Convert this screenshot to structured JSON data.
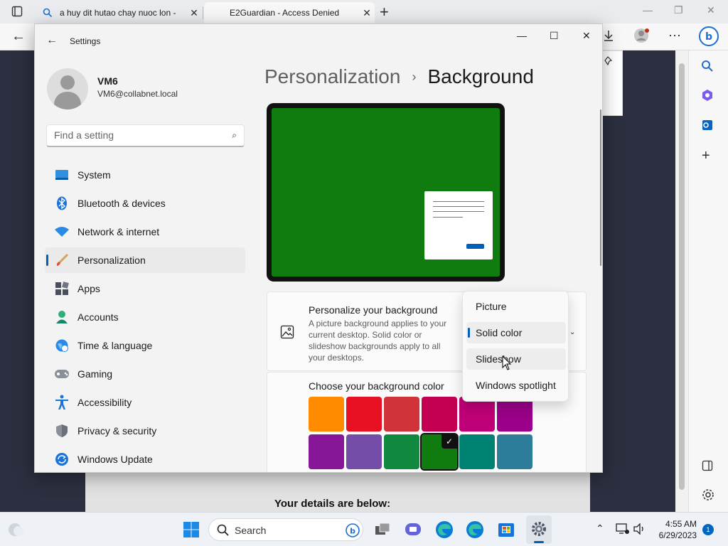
{
  "browser": {
    "tabs": [
      {
        "title": "a huy dit hutao chay nuoc lon -  "
      },
      {
        "title": "E2Guardian - Access Denied"
      }
    ],
    "new_tab_symbol": "+",
    "page_details_text": "Your details are below:"
  },
  "settings": {
    "window_title": "Settings",
    "user": {
      "name": "VM6",
      "email": "VM6@collabnet.local"
    },
    "search_placeholder": "Find a setting",
    "nav": [
      {
        "label": "System",
        "icon": "system-icon"
      },
      {
        "label": "Bluetooth & devices",
        "icon": "bluetooth-icon"
      },
      {
        "label": "Network & internet",
        "icon": "wifi-icon"
      },
      {
        "label": "Personalization",
        "icon": "brush-icon",
        "active": true
      },
      {
        "label": "Apps",
        "icon": "apps-icon"
      },
      {
        "label": "Accounts",
        "icon": "accounts-icon"
      },
      {
        "label": "Time & language",
        "icon": "globe-icon"
      },
      {
        "label": "Gaming",
        "icon": "gamepad-icon"
      },
      {
        "label": "Accessibility",
        "icon": "accessibility-icon"
      },
      {
        "label": "Privacy & security",
        "icon": "shield-icon"
      },
      {
        "label": "Windows Update",
        "icon": "update-icon"
      }
    ],
    "breadcrumb": {
      "parent": "Personalization",
      "separator": "›",
      "current": "Background"
    },
    "preview_color": "#107c10",
    "personalize": {
      "title": "Personalize your background",
      "description": "A picture background applies to your current desktop. Solid color or slideshow backgrounds apply to all your desktops."
    },
    "dropdown": {
      "options": [
        "Picture",
        "Solid color",
        "Slideshow",
        "Windows spotlight"
      ],
      "selected": "Solid color",
      "hovered": "Slideshow"
    },
    "color_section_title": "Choose your background color",
    "colors": [
      [
        "#ff8c00",
        "#e81123",
        "#d13438",
        "#c30052",
        "#bf0077",
        "#9a0089"
      ],
      [
        "#881798",
        "#744da9",
        "#10893e",
        "#107c10",
        "#008272",
        "#2d7d9a"
      ],
      [
        "#005b70",
        "#5a4e9c",
        "#6b69d6",
        "#8764b8",
        "#00635a",
        "#525e54"
      ]
    ],
    "selected_color_index": [
      1,
      3
    ]
  },
  "taskbar": {
    "search_label": "Search",
    "time": "4:55 AM",
    "date": "6/29/2023",
    "notification_count": "1"
  }
}
